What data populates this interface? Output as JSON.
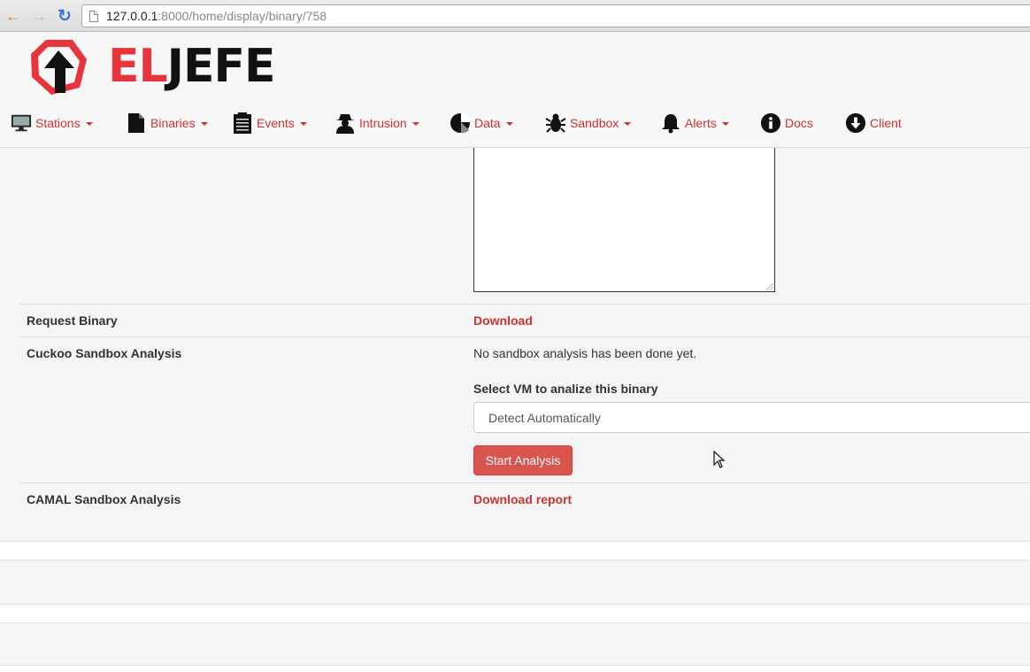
{
  "browser": {
    "url_host": "127.0.0.1",
    "url_path": ":8000/home/display/binary/758",
    "back_icon": "back-arrow-icon",
    "forward_icon": "forward-arrow-icon",
    "reload_icon": "reload-icon"
  },
  "header": {
    "logo_el": "EL",
    "logo_jefe": "JEFE",
    "brand_color": "#e8353c"
  },
  "nav": [
    {
      "label": "Stations",
      "icon": "monitor-icon",
      "dropdown": true
    },
    {
      "label": "Binaries",
      "icon": "file-icon",
      "dropdown": true
    },
    {
      "label": "Events",
      "icon": "clipboard-icon",
      "dropdown": true
    },
    {
      "label": "Intrusion",
      "icon": "spy-icon",
      "dropdown": true
    },
    {
      "label": "Data",
      "icon": "pie-chart-icon",
      "dropdown": true
    },
    {
      "label": "Sandbox",
      "icon": "bug-icon",
      "dropdown": true
    },
    {
      "label": "Alerts",
      "icon": "bell-icon",
      "dropdown": true
    },
    {
      "label": "Docs",
      "icon": "info-icon",
      "dropdown": false
    },
    {
      "label": "Client",
      "icon": "download-circle-icon",
      "dropdown": false
    }
  ],
  "details": {
    "request_binary_label": "Request Binary",
    "request_binary_link": "Download",
    "cuckoo_label": "Cuckoo Sandbox Analysis",
    "cuckoo_status": "No sandbox analysis has been done yet.",
    "select_vm_label": "Select VM to analize this binary",
    "select_vm_value": "Detect Automatically",
    "start_button": "Start Analysis",
    "camal_label": "CAMAL Sandbox Analysis",
    "camal_link": "Download report"
  },
  "colors": {
    "link": "#cc3333",
    "danger_button": "#d9534f"
  }
}
